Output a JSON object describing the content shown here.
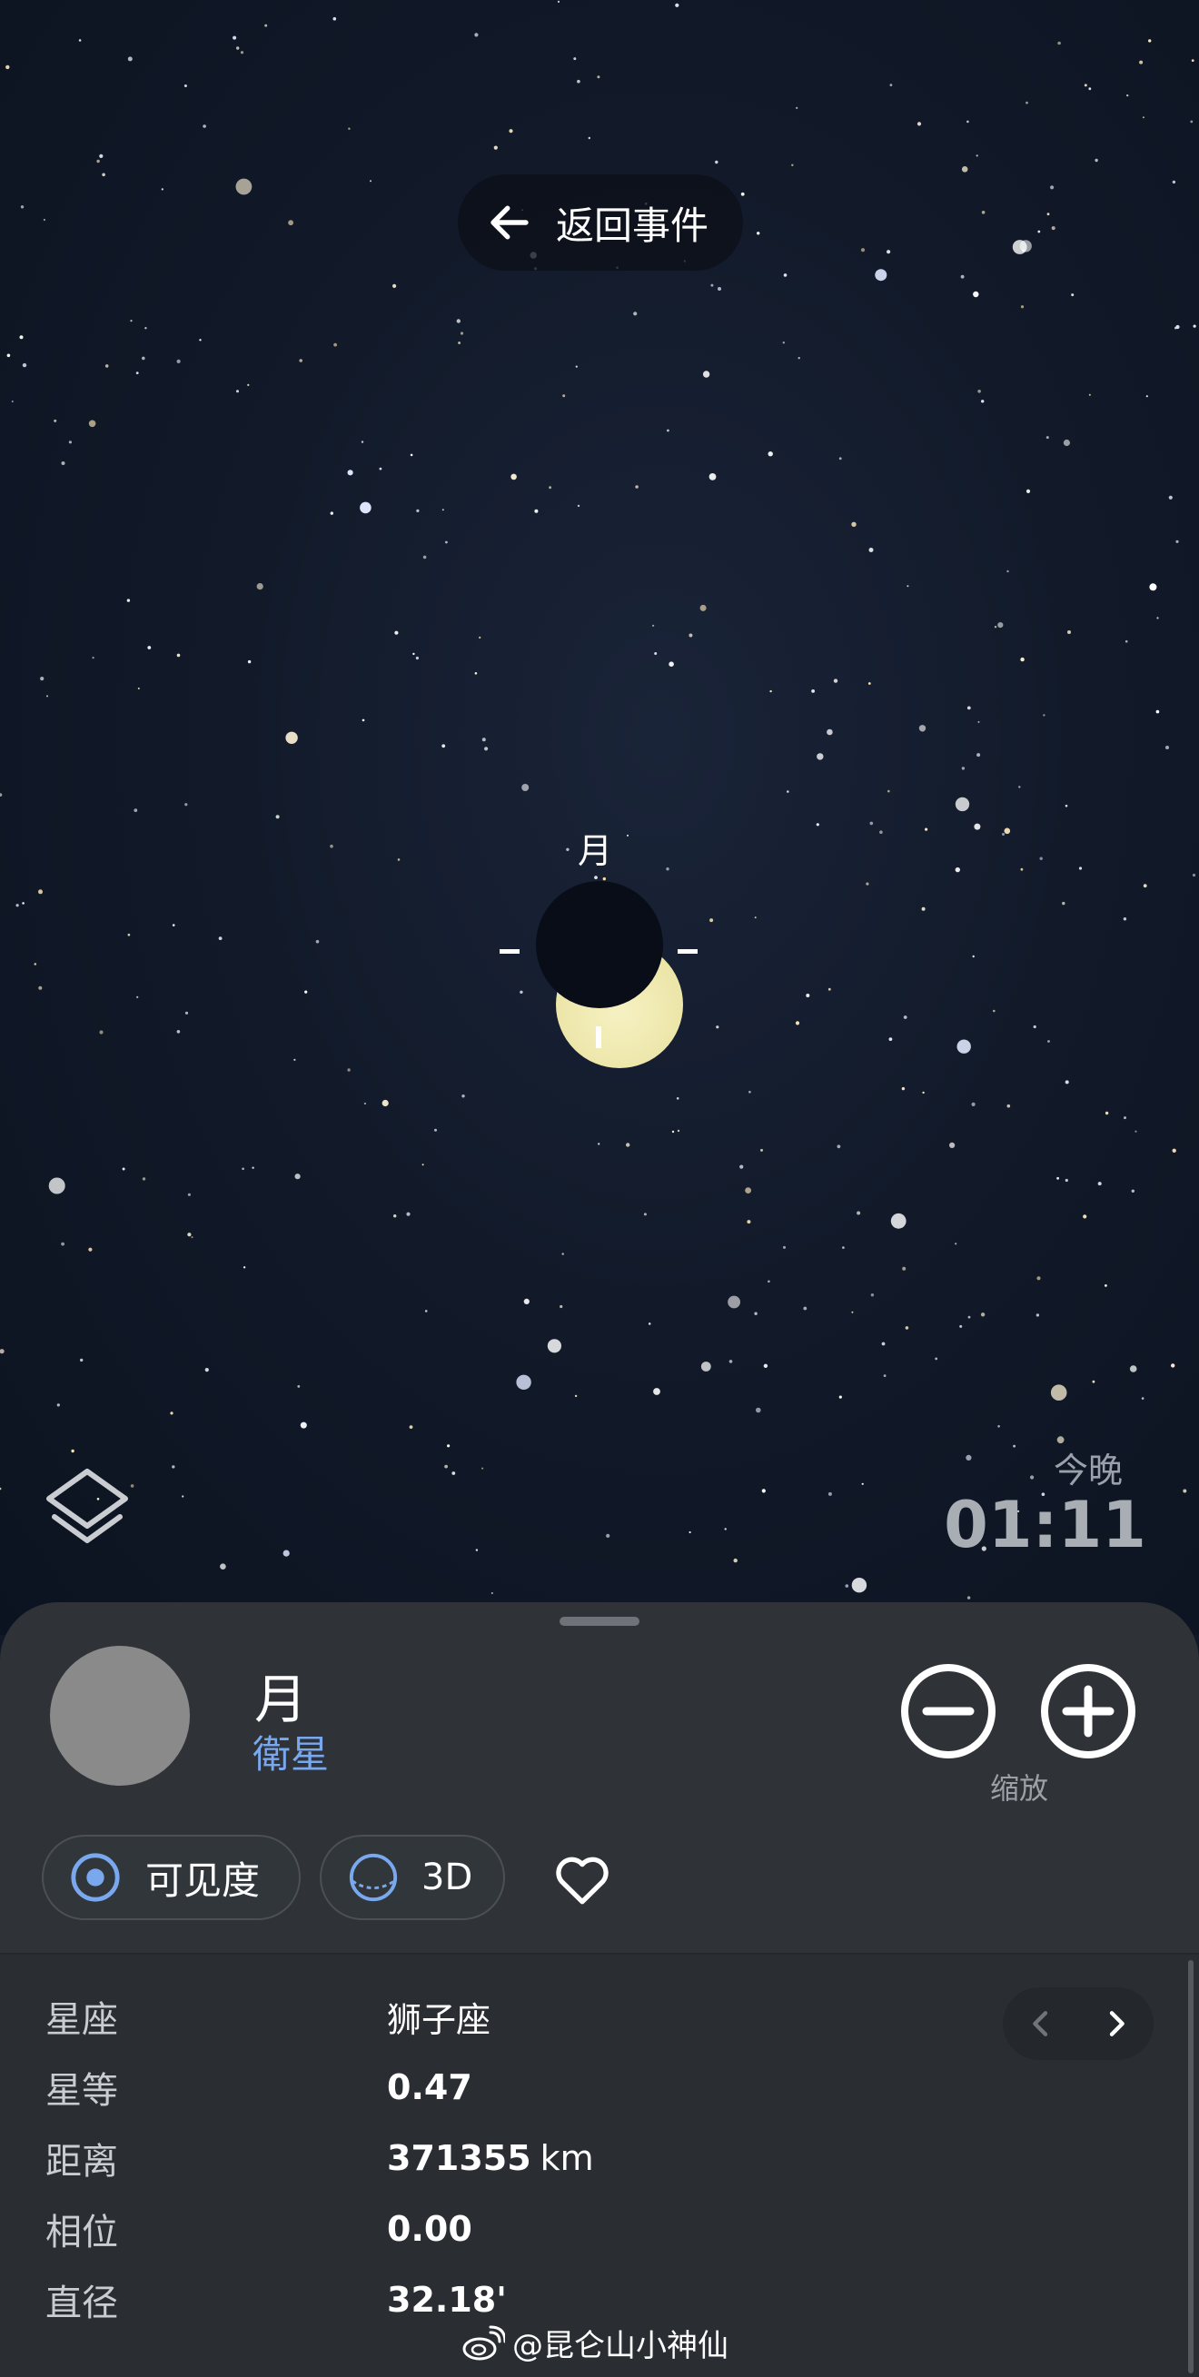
{
  "header": {
    "back_label": "返回事件"
  },
  "sky": {
    "target_label": "月"
  },
  "time": {
    "label": "今晚",
    "value": "01:11"
  },
  "object": {
    "name": "月",
    "type": "衛星",
    "zoom_label": "缩放"
  },
  "chips": {
    "visibility": "可见度",
    "view3d": "3D"
  },
  "details": {
    "rows": [
      {
        "key": "星座",
        "value": "狮子座",
        "unit": ""
      },
      {
        "key": "星等",
        "value": "0.47",
        "unit": ""
      },
      {
        "key": "距离",
        "value": "371355",
        "unit": "km"
      },
      {
        "key": "相位",
        "value": "0.00",
        "unit": ""
      },
      {
        "key": "直径",
        "value": "32.18'",
        "unit": ""
      }
    ]
  },
  "watermark": {
    "text": "@昆仑山小神仙"
  },
  "colors": {
    "accent": "#7aa8ee",
    "sheet": "#2f3338",
    "moon": "#f0e9b0"
  }
}
